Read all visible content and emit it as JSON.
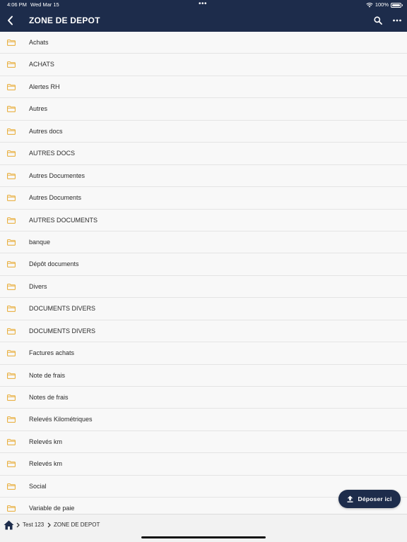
{
  "status_bar": {
    "time": "4:06 PM",
    "date": "Wed Mar 15",
    "multitask_dots": "•••",
    "battery_percent": "100%",
    "battery_level": 1.0
  },
  "header": {
    "title": "ZONE DE DEPOT",
    "back_icon": "chevron-left-icon",
    "search_icon": "search-icon",
    "more_icon": "more-horizontal-icon",
    "background_color": "#1d2c4b"
  },
  "folders": {
    "icon": "folder-icon",
    "icon_color": "#e7a92f",
    "items": [
      "Achats",
      "ACHATS",
      "Alertes RH",
      "Autres",
      "Autres docs",
      "AUTRES DOCS",
      "Autres Documentes",
      "Autres Documents",
      "AUTRES DOCUMENTS",
      "banque",
      "Dépôt documents",
      "Divers",
      "DOCUMENTS DIVERS",
      "DOCUMENTS DIVERS",
      "Factures achats",
      "Note de frais",
      "Notes de frais",
      "Relevés Kilométriques",
      "Relevés km",
      "Relevés km",
      "Social",
      "Variable de paie"
    ]
  },
  "upload": {
    "label": "Déposer ici",
    "icon": "upload-icon"
  },
  "breadcrumb": {
    "home_icon": "home-icon",
    "items": [
      "Test 123",
      "ZONE DE DEPOT"
    ]
  }
}
